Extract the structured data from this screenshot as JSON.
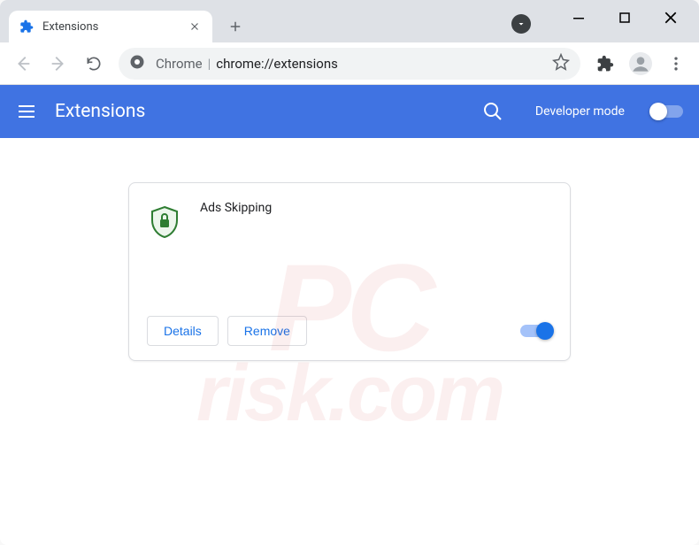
{
  "window": {
    "tab_title": "Extensions",
    "url_prefix": "Chrome",
    "url_path": "chrome://extensions"
  },
  "header": {
    "title": "Extensions",
    "dev_mode_label": "Developer mode"
  },
  "extension": {
    "name": "Ads Skipping",
    "details_label": "Details",
    "remove_label": "Remove"
  },
  "watermark": {
    "line1": "PC",
    "line2": "risk.com"
  }
}
